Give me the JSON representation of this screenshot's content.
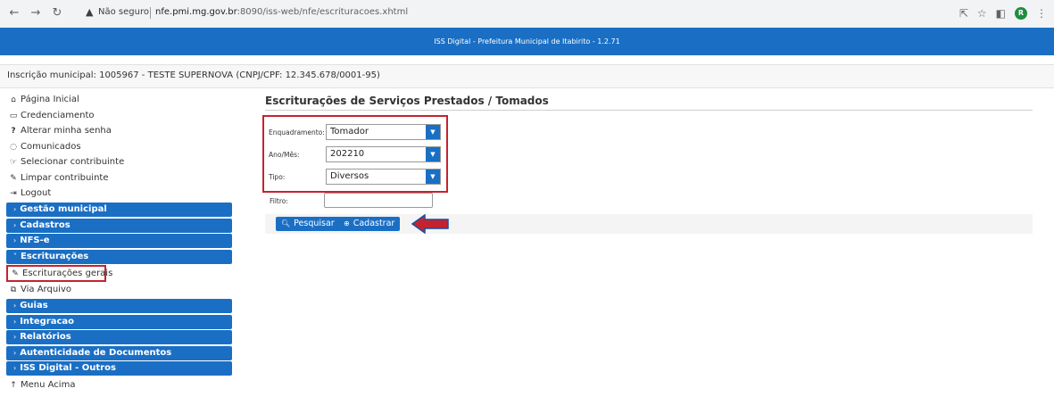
{
  "browser": {
    "back_icon": "arrow-left-icon",
    "forward_icon": "arrow-right-icon",
    "reload_icon": "reload-icon",
    "security_label": "Não seguro",
    "url_host": "nfe.pmi.mg.gov.br",
    "url_path": ":8090/iss-web/nfe/escrituracoes.xhtml",
    "profile_initial": "R"
  },
  "header": {
    "title": "ISS Digital - Prefeitura Municipal de Itabirito - 1.2.71"
  },
  "info": {
    "text": "Inscrição municipal: 1005967 - TESTE SUPERNOVA (CNPJ/CPF: 12.345.678/0001-95)"
  },
  "sidebar": {
    "links_top": [
      {
        "icon": "home-icon",
        "label": "Página Inicial"
      },
      {
        "icon": "credential-icon",
        "label": "Credenciamento"
      },
      {
        "icon": "question-icon",
        "label": "Alterar minha senha"
      },
      {
        "icon": "chat-icon",
        "label": "Comunicados"
      },
      {
        "icon": "hand-pointer-icon",
        "label": "Selecionar contribuinte"
      },
      {
        "icon": "eraser-icon",
        "label": "Limpar contribuinte"
      },
      {
        "icon": "logout-icon",
        "label": "Logout"
      }
    ],
    "sections_a": [
      "Gestão municipal",
      "Cadastros",
      "NFS-e"
    ],
    "section_open": "Escriturações",
    "sub_items": [
      {
        "icon": "edit-icon",
        "label": "Escriturações gerais"
      },
      {
        "icon": "external-link-icon",
        "label": "Via Arquivo"
      }
    ],
    "sections_b": [
      "Guias",
      "Integracao",
      "Relatórios",
      "Autenticidade de Documentos",
      "ISS Digital - Outros"
    ],
    "menu_up": {
      "icon": "arrow-up-icon",
      "label": "Menu Acima"
    }
  },
  "main": {
    "title": "Escriturações de Serviços Prestados / Tomados",
    "fields": {
      "enquadramento": {
        "label": "Enquadramento:",
        "value": "Tomador"
      },
      "ano_mes": {
        "label": "Ano/Mês:",
        "value": "202210"
      },
      "tipo": {
        "label": "Tipo:",
        "value": "Diversos"
      }
    },
    "filter": {
      "label": "Filtro:",
      "value": ""
    },
    "buttons": {
      "search": "Pesquisar",
      "register": "Cadastrar"
    }
  },
  "colors": {
    "primary": "#1a6fc4",
    "highlight": "#c4232e"
  }
}
